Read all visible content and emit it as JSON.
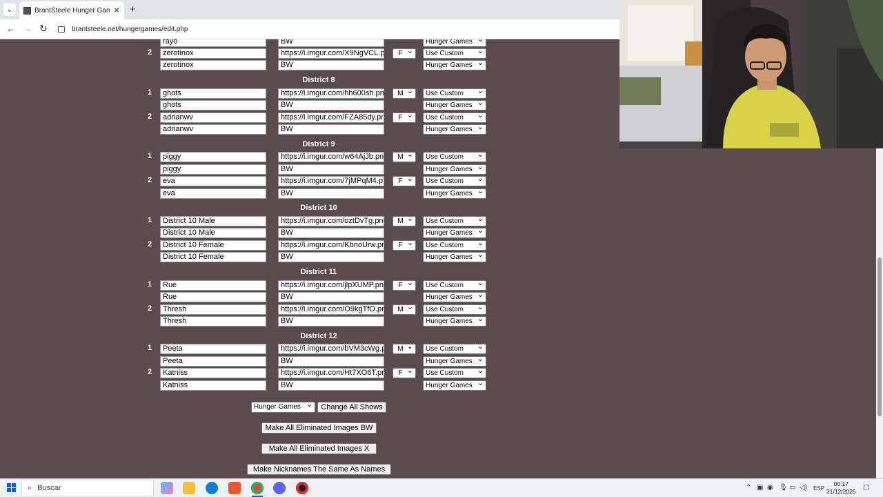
{
  "browser": {
    "tab_title": "BrantSteele Hunger Games Sim",
    "url": "brantsteele.net/hungergames/edit.php"
  },
  "partial_top": {
    "name_above": "rayo",
    "image_above": "BW",
    "show_above": "Hunger Games",
    "tribute2": {
      "number": "2",
      "name": "zerotinox",
      "image": "https://i.imgur.com/X9NgVCL.p",
      "gender": "F",
      "image_type": "Use Custom",
      "dead_name": "zerotinox",
      "dead_image": "BW",
      "dead_type": "Hunger Games"
    }
  },
  "districts": [
    {
      "title": "District 8",
      "tributes": [
        {
          "number": "1",
          "name": "ghots",
          "image": "https://i.imgur.com/hh600sh.pn",
          "gender": "M",
          "image_type": "Use Custom",
          "dead_name": "ghots",
          "dead_image": "BW",
          "dead_type": "Hunger Games"
        },
        {
          "number": "2",
          "name": "adrianwv",
          "image": "https://i.imgur.com/FZA85dy.pr",
          "gender": "F",
          "image_type": "Use Custom",
          "dead_name": "adrianwv",
          "dead_image": "BW",
          "dead_type": "Hunger Games"
        }
      ]
    },
    {
      "title": "District 9",
      "tributes": [
        {
          "number": "1",
          "name": "piggy",
          "image": "https://i.imgur.com/w64AjJb.pn",
          "gender": "M",
          "image_type": "Use Custom",
          "dead_name": "piggy",
          "dead_image": "BW",
          "dead_type": "Hunger Games"
        },
        {
          "number": "2",
          "name": "eva",
          "image": "https://i.imgur.com/7jMPqM4.p",
          "gender": "F",
          "image_type": "Use Custom",
          "dead_name": "eva",
          "dead_image": "BW",
          "dead_type": "Hunger Games"
        }
      ]
    },
    {
      "title": "District 10",
      "tributes": [
        {
          "number": "1",
          "name": "District 10 Male",
          "image": "https://i.imgur.com/oztDvTg.pn",
          "gender": "M",
          "image_type": "Use Custom",
          "dead_name": "District 10 Male",
          "dead_image": "BW",
          "dead_type": "Hunger Games"
        },
        {
          "number": "2",
          "name": "District 10 Female",
          "image": "https://i.imgur.com/KbnoUrw.pr",
          "gender": "F",
          "image_type": "Use Custom",
          "dead_name": "District 10 Female",
          "dead_image": "BW",
          "dead_type": "Hunger Games"
        }
      ]
    },
    {
      "title": "District 11",
      "tributes": [
        {
          "number": "1",
          "name": "Rue",
          "image": "https://i.imgur.com/jlpXUMP.pn",
          "gender": "F",
          "image_type": "Use Custom",
          "dead_name": "Rue",
          "dead_image": "BW",
          "dead_type": "Hunger Games"
        },
        {
          "number": "2",
          "name": "Thresh",
          "image": "https://i.imgur.com/O9kgTfO.pr",
          "gender": "M",
          "image_type": "Use Custom",
          "dead_name": "Thresh",
          "dead_image": "BW",
          "dead_type": "Hunger Games"
        }
      ]
    },
    {
      "title": "District 12",
      "tributes": [
        {
          "number": "1",
          "name": "Peeta",
          "image": "https://i.imgur.com/bVM3cWg.p",
          "gender": "M",
          "image_type": "Use Custom",
          "dead_name": "Peeta",
          "dead_image": "BW",
          "dead_type": "Hunger Games"
        },
        {
          "number": "2",
          "name": "Katniss",
          "image": "https://i.imgur.com/Ht7XO6T.pr",
          "gender": "F",
          "image_type": "Use Custom",
          "dead_name": "Katniss",
          "dead_image": "BW",
          "dead_type": "Hunger Games"
        }
      ]
    }
  ],
  "controls": {
    "all_shows_select": "Hunger Games",
    "change_all_shows": "Change All Shows",
    "make_all_bw": "Make All Eliminated Images BW",
    "make_all_x": "Make All Eliminated Images X",
    "nicknames_same": "Make Nicknames The Same As Names"
  },
  "taskbar": {
    "search_placeholder": "Buscar",
    "language": "ESP",
    "time": "00:17",
    "date": "31/12/2025"
  }
}
